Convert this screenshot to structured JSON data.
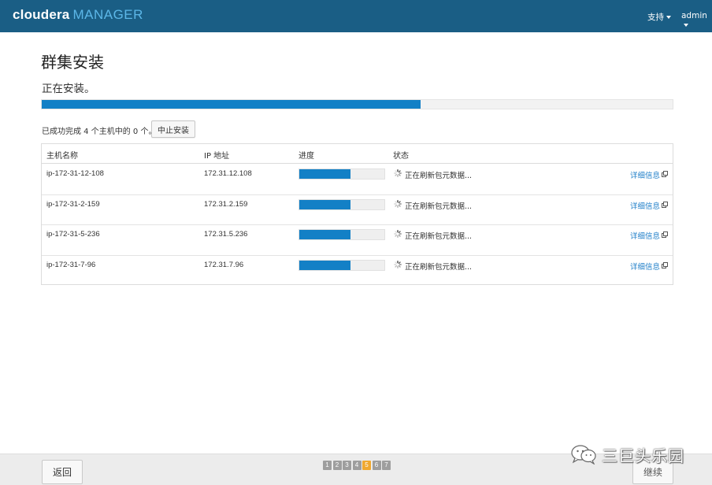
{
  "header": {
    "logo_part1": "cloudera",
    "logo_part2": "MANAGER",
    "support_menu": "支持",
    "user_menu": "admin",
    "bar_color": "#1a5e85"
  },
  "page": {
    "title": "群集安装",
    "status": "正在安装。",
    "overall_progress": 0.6,
    "summary": "已成功完成 4 个主机中的 0 个。",
    "abort_label": "中止安装"
  },
  "table": {
    "headers": {
      "host": "主机名称",
      "ip": "IP 地址",
      "progress": "进度",
      "status": "状态"
    },
    "rows": [
      {
        "host": "ip-172-31-12-108",
        "ip": "172.31.12.108",
        "progress": 0.6,
        "status": "正在刷新包元数据...",
        "detail": "详细信息"
      },
      {
        "host": "ip-172-31-2-159",
        "ip": "172.31.2.159",
        "progress": 0.6,
        "status": "正在刷新包元数据...",
        "detail": "详细信息"
      },
      {
        "host": "ip-172-31-5-236",
        "ip": "172.31.5.236",
        "progress": 0.6,
        "status": "正在刷新包元数据...",
        "detail": "详细信息"
      },
      {
        "host": "ip-172-31-7-96",
        "ip": "172.31.7.96",
        "progress": 0.6,
        "status": "正在刷新包元数据...",
        "detail": "详细信息"
      }
    ]
  },
  "footer": {
    "back_label": "返回",
    "continue_label": "继续",
    "steps": [
      "1",
      "2",
      "3",
      "4",
      "5",
      "6",
      "7"
    ],
    "active_step": "5"
  },
  "watermark": {
    "text": "三巨头乐园",
    "icon": "wechat-icon"
  },
  "colors": {
    "accent": "#1380c6",
    "link": "#1e7ec8",
    "active_step": "#f0a830"
  }
}
